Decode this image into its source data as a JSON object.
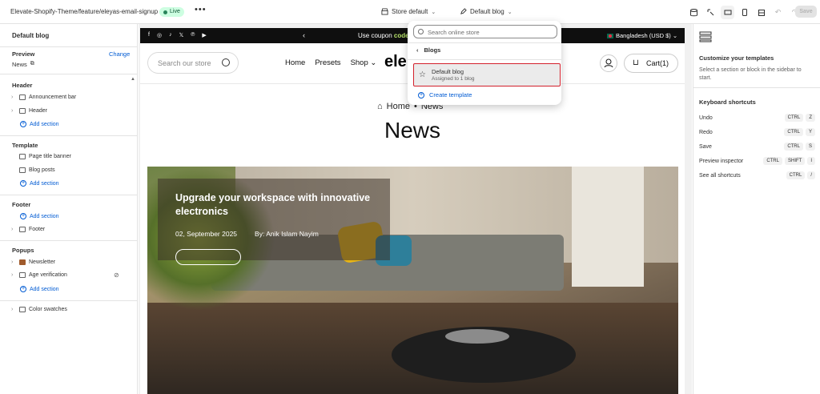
{
  "topbar": {
    "path": "Elevate-Shopify-Theme/feature/eleyas-email-signup",
    "status": "Live",
    "more": "•••",
    "store_select": "Store default",
    "template_select": "Default blog",
    "save_label": "Save"
  },
  "left": {
    "title": "Default blog",
    "preview_label": "Preview",
    "change_label": "Change",
    "preview_value": "News",
    "sections": [
      {
        "title": "Header",
        "items": [
          "Announcement bar",
          "Header"
        ],
        "add": "Add section"
      },
      {
        "title": "Template",
        "items": [
          "Page title banner",
          "Blog posts"
        ],
        "add": "Add section"
      },
      {
        "title": "Footer",
        "add": "Add section",
        "items": [
          "Footer"
        ]
      },
      {
        "title": "Popups",
        "items": [
          "Newsletter",
          "Age verification"
        ],
        "add": "Add section"
      }
    ],
    "extra_item": "Color swatches"
  },
  "site": {
    "announcement": {
      "prefix": "Use coupon ",
      "code": "code",
      "country": "Bangladesh (USD $)"
    },
    "search_placeholder": "Search our store",
    "menu": [
      "Home",
      "Presets",
      "Shop"
    ],
    "logo": "ele",
    "cart": "Cart(1)",
    "breadcrumb": {
      "home": "Home",
      "sep": "•",
      "current": "News"
    },
    "page_title": "News",
    "hero": {
      "title": "Upgrade your workspace with innovative electronics",
      "date": "02, September 2025",
      "author": "By: Anik Islam Nayim"
    }
  },
  "dropdown": {
    "search_placeholder": "Search online store",
    "back_label": "Blogs",
    "item_title": "Default blog",
    "item_sub": "Assigned to 1 blog",
    "create_label": "Create template"
  },
  "right": {
    "heading": "Customize your templates",
    "desc": "Select a section or block in the sidebar to start.",
    "kb_title": "Keyboard shortcuts",
    "shortcuts": [
      {
        "label": "Undo",
        "keys": [
          "CTRL",
          "Z"
        ]
      },
      {
        "label": "Redo",
        "keys": [
          "CTRL",
          "Y"
        ]
      },
      {
        "label": "Save",
        "keys": [
          "CTRL",
          "S"
        ]
      },
      {
        "label": "Preview inspector",
        "keys": [
          "CTRL",
          "SHIFT",
          "I"
        ]
      },
      {
        "label": "See all shortcuts",
        "keys": [
          "CTRL",
          "/"
        ]
      }
    ]
  }
}
